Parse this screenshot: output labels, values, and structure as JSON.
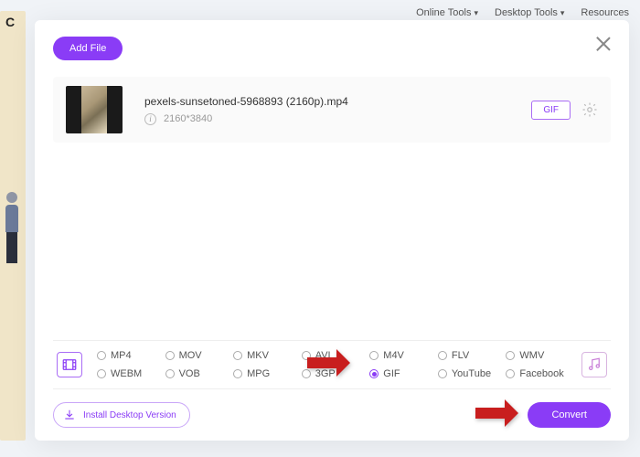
{
  "backdrop": {
    "logo": "C",
    "nav": [
      "Online Tools",
      "Desktop Tools",
      "Resources"
    ]
  },
  "modal": {
    "add_file_label": "Add File",
    "file": {
      "name": "pexels-sunsetoned-5968893 (2160p).mp4",
      "resolution": "2160*3840",
      "format_badge": "GIF"
    },
    "formats": {
      "row1": [
        "MP4",
        "MOV",
        "MKV",
        "AVI",
        "M4V",
        "FLV",
        "WMV"
      ],
      "row2": [
        "WEBM",
        "VOB",
        "MPG",
        "3GP",
        "GIF",
        "YouTube",
        "Facebook"
      ],
      "selected": "GIF"
    },
    "install_label": "Install Desktop Version",
    "convert_label": "Convert"
  },
  "colors": {
    "accent": "#8a3cf6"
  }
}
